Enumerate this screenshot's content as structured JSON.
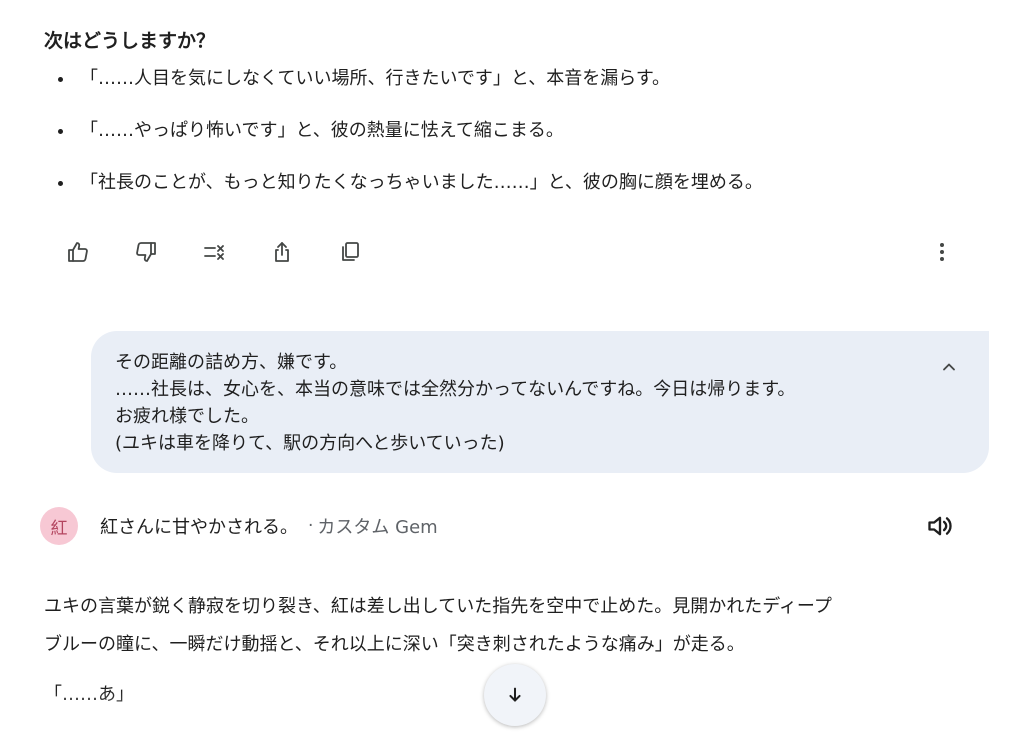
{
  "question": {
    "heading": "次はどうしますか？",
    "options": [
      "「……人目を気にしなくていい場所、行きたいです」と、本音を漏らす。",
      "「……やっぱり怖いです」と、彼の熱量に怯えて縮こまる。",
      "「社長のことが、もっと知りたくなっちゃいました……」と、彼の胸に顔を埋める。"
    ]
  },
  "actions": {
    "icons": [
      "thumbs-up-icon",
      "thumbs-down-icon",
      "double-check-icon",
      "share-icon",
      "copy-icon",
      "more-vert-icon"
    ]
  },
  "user_message": {
    "lines": [
      "その距離の詰め方、嫌です。",
      "……社長は、女心を、本当の意味では全然分かってないんですね。今日は帰ります。",
      "お疲れ様でした。",
      "(ユキは車を降りて、駅の方向へと歩いていった)"
    ],
    "collapse_icon": "chevron-up-icon"
  },
  "gem": {
    "avatar_text": "紅",
    "name": "紅さんに甘やかされる。",
    "separator": "·",
    "tag": "カスタム Gem",
    "avatar_bg": "#f7c8d4",
    "avatar_fg": "#b3455f",
    "speaker_icon": "volume-icon"
  },
  "response": {
    "lines": [
      "ユキの言葉が鋭く静寂を切り裂き、紅は差し出していた指先を空中で止めた。見開かれたディープ",
      "ブルーの瞳に、一瞬だけ動揺と、それ以上に深い「突き刺されたような痛み」が走る。"
    ],
    "last_line": "「……あ」"
  },
  "scroll_down_icon": "arrow-down-icon",
  "colors": {
    "bubble_bg": "#e9eef6",
    "text": "#1f1f1f",
    "secondary_text": "#5f6368",
    "icon": "#444746"
  }
}
